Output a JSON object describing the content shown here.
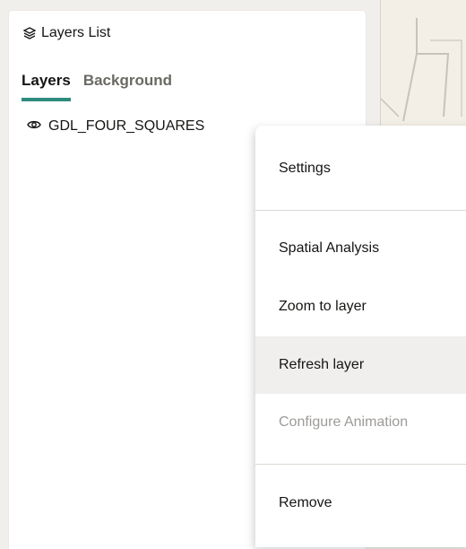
{
  "panel": {
    "title": "Layers List",
    "title_icon": "layers-icon"
  },
  "tabs": [
    {
      "label": "Layers",
      "active": true
    },
    {
      "label": "Background",
      "active": false
    }
  ],
  "layers": [
    {
      "name": "GDL_FOUR_SQUARES",
      "icon": "eye-icon"
    }
  ],
  "context_menu": {
    "items": [
      {
        "label": "Settings",
        "enabled": true
      },
      {
        "label": "Spatial Analysis",
        "enabled": true
      },
      {
        "label": "Zoom to layer",
        "enabled": true
      },
      {
        "label": "Refresh layer",
        "enabled": true,
        "hovered": true
      },
      {
        "label": "Configure Animation",
        "enabled": false
      },
      {
        "label": "Remove",
        "enabled": true
      }
    ]
  },
  "colors": {
    "accent": "#2e8b7e",
    "hover_bg": "#f1efed",
    "disabled_text": "#9d9b97"
  }
}
